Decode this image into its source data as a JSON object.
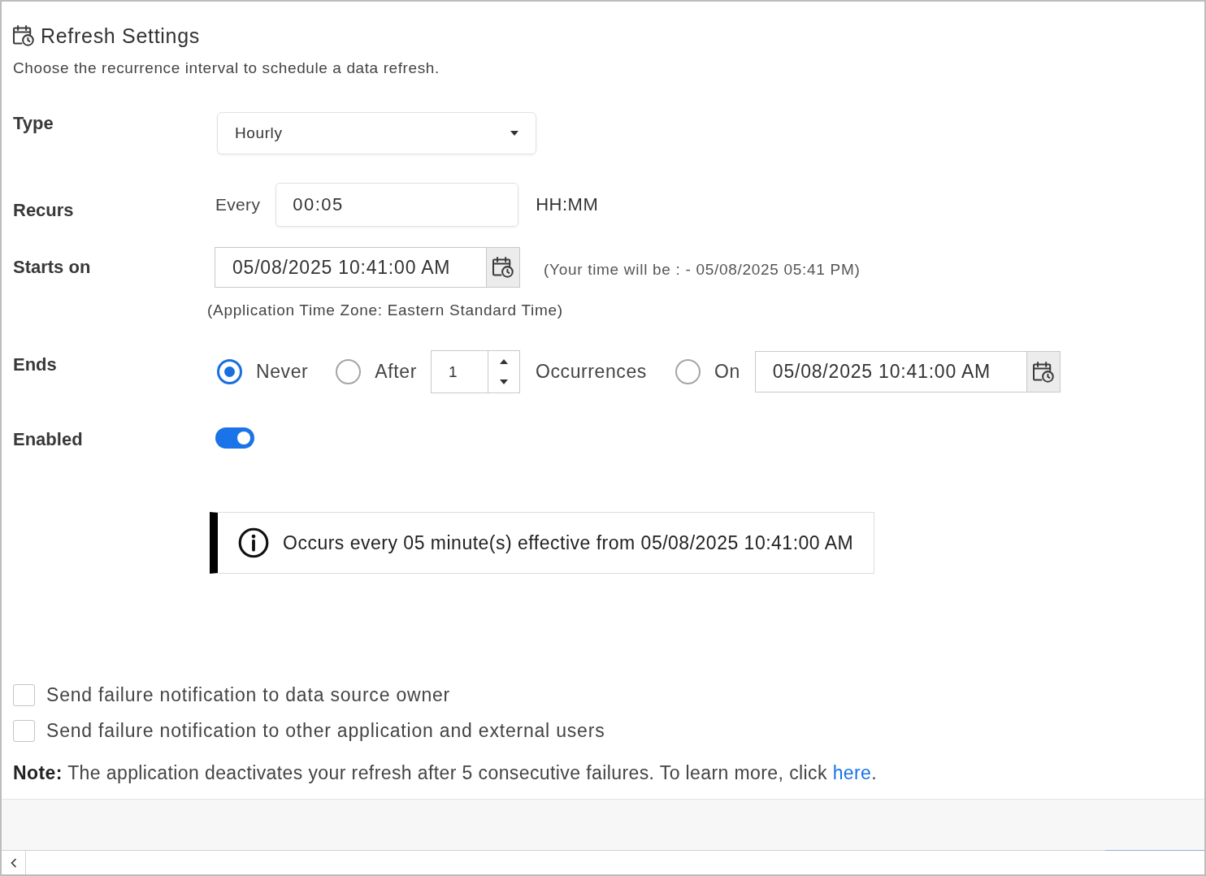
{
  "header": {
    "title": "Refresh Settings",
    "description": "Choose the recurrence interval to schedule a data refresh."
  },
  "form": {
    "type": {
      "label": "Type",
      "value": "Hourly"
    },
    "recurs": {
      "label": "Recurs",
      "prefix": "Every",
      "value": "00:05",
      "unit": "HH:MM"
    },
    "starts_on": {
      "label": "Starts on",
      "value": "05/08/2025 10:41:00 AM",
      "local_time": "(Your time will be : - 05/08/2025 05:41 PM)",
      "time_zone": "(Application Time Zone: Eastern Standard Time)"
    },
    "ends": {
      "label": "Ends",
      "options": [
        {
          "kind": "never",
          "label": "Never",
          "selected": true
        },
        {
          "kind": "count",
          "label": "After",
          "value": "1",
          "suffix": "Occurrences",
          "selected": false
        },
        {
          "kind": "date",
          "label": "On",
          "value": "05/08/2025 10:41:00 AM",
          "selected": false
        }
      ]
    },
    "enabled": {
      "label": "Enabled",
      "on": true
    }
  },
  "summary": {
    "text": "Occurs every 05 minute(s) effective from 05/08/2025 10:41:00 AM"
  },
  "notifications": [
    {
      "label": "Send failure notification to data source owner",
      "checked": false
    },
    {
      "label": "Send failure notification to other application and external users",
      "checked": false
    }
  ],
  "note": {
    "text": "**Note:** The application deactivates your refresh after 5 consecutive failures. To learn more, click",
    "link": "here",
    "after": "."
  }
}
